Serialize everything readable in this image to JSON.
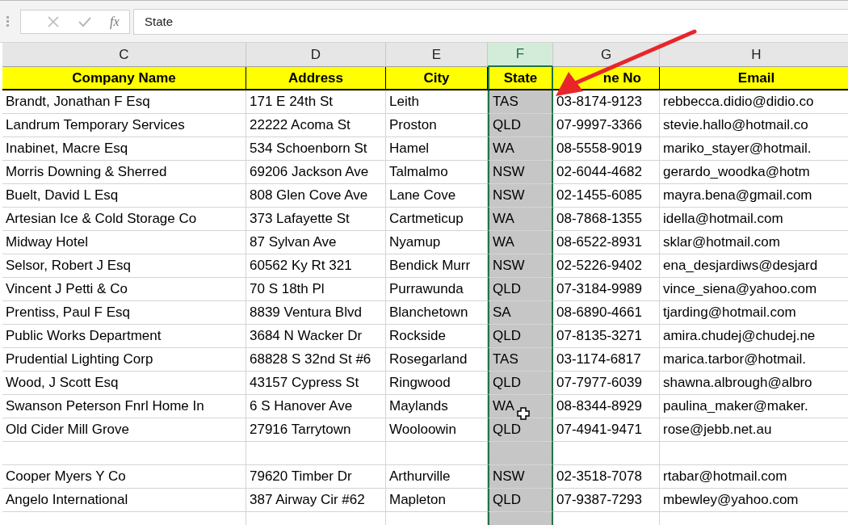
{
  "formula_bar": {
    "function_label": "fx",
    "value": "State"
  },
  "columns": [
    {
      "letter": "C",
      "selected": false
    },
    {
      "letter": "D",
      "selected": false
    },
    {
      "letter": "E",
      "selected": false
    },
    {
      "letter": "F",
      "selected": true
    },
    {
      "letter": "G",
      "selected": false
    },
    {
      "letter": "H",
      "selected": false
    }
  ],
  "header_row": [
    "Company Name",
    "Address",
    "City",
    "State",
    "ne No",
    "Email"
  ],
  "rows": [
    {
      "kind": "data",
      "cells": [
        "Brandt, Jonathan F Esq",
        "171 E 24th St",
        "Leith",
        "TAS",
        "03-8174-9123",
        "rebbecca.didio@didio.co"
      ]
    },
    {
      "kind": "data",
      "cells": [
        "Landrum Temporary Services",
        "22222 Acoma St",
        "Proston",
        "QLD",
        "07-9997-3366",
        "stevie.hallo@hotmail.co"
      ]
    },
    {
      "kind": "data",
      "cells": [
        "Inabinet, Macre Esq",
        "534 Schoenborn St",
        "Hamel",
        "WA",
        "08-5558-9019",
        "mariko_stayer@hotmail."
      ]
    },
    {
      "kind": "data",
      "cells": [
        "Morris Downing & Sherred",
        "69206 Jackson Ave",
        "Talmalmo",
        "NSW",
        "02-6044-4682",
        "gerardo_woodka@hotm"
      ]
    },
    {
      "kind": "data",
      "cells": [
        "Buelt, David L Esq",
        "808 Glen Cove Ave",
        "Lane Cove",
        "NSW",
        "02-1455-6085",
        "mayra.bena@gmail.com"
      ]
    },
    {
      "kind": "data",
      "cells": [
        "Artesian Ice & Cold Storage Co",
        "373 Lafayette St",
        "Cartmeticup",
        "WA",
        "08-7868-1355",
        "idella@hotmail.com"
      ]
    },
    {
      "kind": "data",
      "cells": [
        "Midway Hotel",
        "87 Sylvan Ave",
        "Nyamup",
        "WA",
        "08-6522-8931",
        "sklar@hotmail.com"
      ]
    },
    {
      "kind": "data",
      "cells": [
        "Selsor, Robert J Esq",
        "60562 Ky Rt 321",
        "Bendick Murr",
        "NSW",
        "02-5226-9402",
        "ena_desjardiws@desjard"
      ]
    },
    {
      "kind": "data",
      "cells": [
        "Vincent J Petti & Co",
        "70 S 18th Pl",
        "Purrawunda",
        "QLD",
        "07-3184-9989",
        "vince_siena@yahoo.com"
      ]
    },
    {
      "kind": "data",
      "cells": [
        "Prentiss, Paul F Esq",
        "8839 Ventura Blvd",
        "Blanchetown",
        "SA",
        "08-6890-4661",
        "tjarding@hotmail.com"
      ]
    },
    {
      "kind": "data",
      "cells": [
        "Public Works Department",
        "3684 N Wacker Dr",
        "Rockside",
        "QLD",
        "07-8135-3271",
        "amira.chudej@chudej.ne"
      ]
    },
    {
      "kind": "data",
      "cells": [
        "Prudential Lighting Corp",
        "68828 S 32nd St #6",
        "Rosegarland",
        "TAS",
        "03-1174-6817",
        "marica.tarbor@hotmail."
      ]
    },
    {
      "kind": "data",
      "cells": [
        "Wood, J Scott Esq",
        "43157 Cypress St",
        "Ringwood",
        "QLD",
        "07-7977-6039",
        "shawna.albrough@albro"
      ]
    },
    {
      "kind": "data",
      "cells": [
        "Swanson Peterson Fnrl Home In",
        "6 S Hanover Ave",
        "Maylands",
        "WA",
        "08-8344-8929",
        "paulina_maker@maker."
      ]
    },
    {
      "kind": "data",
      "cells": [
        "Old Cider Mill Grove",
        "27916 Tarrytown",
        "Wooloowin",
        "QLD",
        "07-4941-9471",
        "rose@jebb.net.au"
      ]
    },
    {
      "kind": "blank"
    },
    {
      "kind": "data",
      "cells": [
        "Cooper Myers Y Co",
        "79620 Timber Dr",
        "Arthurville",
        "NSW",
        "02-3518-7078",
        "rtabar@hotmail.com"
      ]
    },
    {
      "kind": "data",
      "cells": [
        "Angelo International",
        "387 Airway Cir #62",
        "Mapleton",
        "QLD",
        "07-9387-7293",
        "mbewley@yahoo.com"
      ]
    }
  ]
}
